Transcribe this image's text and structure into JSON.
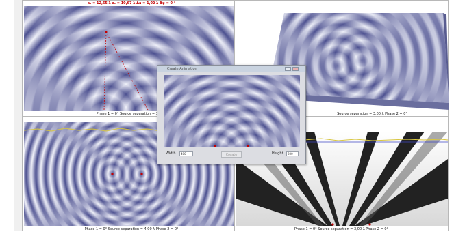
{
  "colors": {
    "wave_light": "#f1f2fa",
    "wave_dark": "#4b4f8f",
    "ridge_red": "#c40000",
    "yellow_line": "#d8c640",
    "blue_line": "#3f46c4"
  },
  "top_left": {
    "readout": "a₁ = 12,65 λ    a₂ = 10,67 λ    Δa = 1,02 λ    Δφ = 0 °",
    "caption": "Phase 1 = 0°    Source separation = 3,99 λ"
  },
  "top_right": {
    "caption": "Source separation = 3,00 λ    Phase 2 = 0°"
  },
  "bottom_left": {
    "caption": "Phase 1 = 0°    Source separation = 4,00 λ    Phase 2 = 0°"
  },
  "bottom_right": {
    "caption": "Phase 1 = 0°    Source separation = 3,00 λ    Phase 2 = 0°"
  },
  "dialog": {
    "title": "Create Animation",
    "width_label": "Width",
    "width_value": "400",
    "height_label": "Height",
    "height_value": "300",
    "button_label": "Create"
  }
}
